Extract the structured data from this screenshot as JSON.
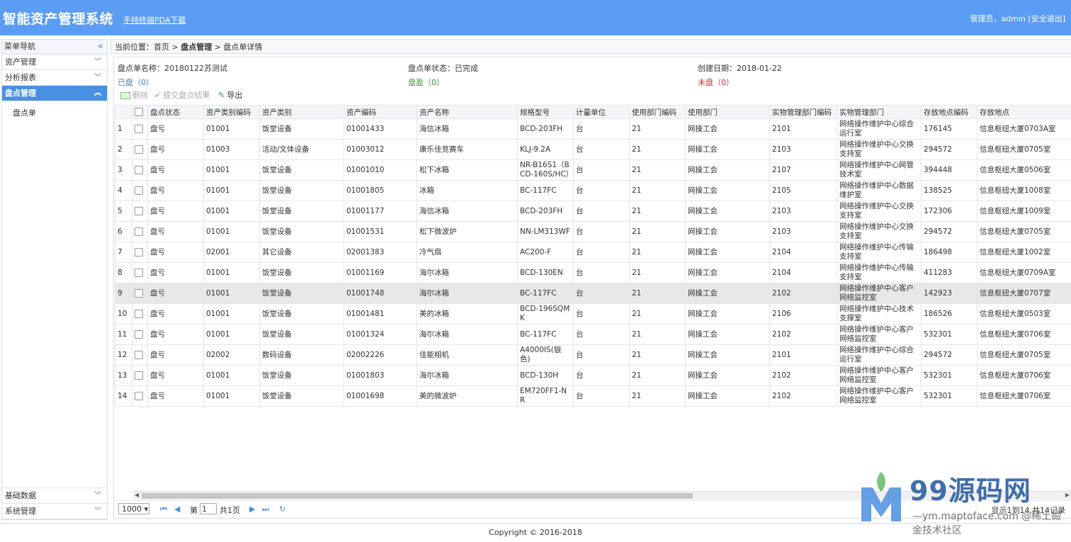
{
  "header": {
    "title": "智能资产管理系统",
    "pda_link": "手持终端PDA下载",
    "user": "管理员，admin",
    "logout": "[安全退出]"
  },
  "sidebar": {
    "heading": "菜单导航",
    "sections": [
      {
        "label": "资产管理"
      },
      {
        "label": "分析报表"
      },
      {
        "label": "盘点管理"
      }
    ],
    "sub_items": [
      {
        "label": "盘点单"
      }
    ],
    "bottom_sections": [
      {
        "label": "基础数据"
      },
      {
        "label": "系统管理"
      }
    ]
  },
  "breadcrumb": {
    "prefix": "当前位置：首页 >",
    "level1": "盘点管理",
    "level2": "> 盘点单详情"
  },
  "info": {
    "name": "盘点单名称：20180122苏测试",
    "status": "盘点单状态：已完成",
    "date": "创建日期：2018-01-22",
    "counted": "已盘（0）",
    "surplus": "盘盈（0）",
    "uncounted": "未盘（0）"
  },
  "toolbar": {
    "delete": "删除",
    "submit": "提交盘点结果",
    "export": "导出"
  },
  "table": {
    "columns": [
      "盘点状态",
      "资产类别编码",
      "资产类别",
      "资产编码",
      "资产名称",
      "规格型号",
      "计量单位",
      "使用部门编码",
      "使用部门",
      "实物管理部门编码",
      "实物管理部门",
      "存放地点编码",
      "存放地点"
    ],
    "rows": [
      [
        "1",
        "盘亏",
        "01001",
        "饭堂设备",
        "01001433",
        "海信冰箱",
        "BCD-203FH",
        "台",
        "21",
        "网操工会",
        "2101",
        "网络操作维护中心综合运行室",
        "176145",
        "信息枢纽大厦0703A室"
      ],
      [
        "2",
        "盘亏",
        "01003",
        "活动/文体设备",
        "01003012",
        "康乐佳竞赛车",
        "KLJ-9.2A",
        "台",
        "21",
        "网操工会",
        "2103",
        "网络操作维护中心交换支持室",
        "294572",
        "信息枢纽大厦0705室"
      ],
      [
        "3",
        "盘亏",
        "01001",
        "饭堂设备",
        "01001010",
        "松下冰箱",
        "NR-B16S1（BCD-160S/HC）",
        "台",
        "21",
        "网操工会",
        "2107",
        "网络操作维护中心网管技术室",
        "394448",
        "信息枢纽大厦0506室"
      ],
      [
        "4",
        "盘亏",
        "01001",
        "饭堂设备",
        "01001805",
        "冰箱",
        "BC-117FC",
        "台",
        "21",
        "网操工会",
        "2105",
        "网络操作维护中心数据维护室",
        "138525",
        "信息枢纽大厦1008室"
      ],
      [
        "5",
        "盘亏",
        "01001",
        "饭堂设备",
        "01001177",
        "海信冰箱",
        "BCD-203FH",
        "台",
        "21",
        "网操工会",
        "2103",
        "网络操作维护中心交换支持室",
        "172306",
        "信息枢纽大厦1009室"
      ],
      [
        "6",
        "盘亏",
        "01001",
        "饭堂设备",
        "01001531",
        "松下微波炉",
        "NN-LM313WF",
        "台",
        "21",
        "网操工会",
        "2103",
        "网络操作维护中心交换支持室",
        "294572",
        "信息枢纽大厦0705室"
      ],
      [
        "7",
        "盘亏",
        "02001",
        "其它设备",
        "02001383",
        "冷气扇",
        "AC200-F",
        "台",
        "21",
        "网操工会",
        "2104",
        "网络操作维护中心传输支持室",
        "186498",
        "信息枢纽大厦1002室"
      ],
      [
        "8",
        "盘亏",
        "01001",
        "饭堂设备",
        "01001169",
        "海尔冰箱",
        "BCD-130EN",
        "台",
        "21",
        "网操工会",
        "2104",
        "网络操作维护中心传输支持室",
        "411283",
        "信息枢纽大厦0709A室"
      ],
      [
        "9",
        "盘亏",
        "01001",
        "饭堂设备",
        "01001748",
        "海尔冰箱",
        "BC-117FC",
        "台",
        "21",
        "网操工会",
        "2102",
        "网络操作维护中心客户网络监控室",
        "142923",
        "信息枢纽大厦0707室"
      ],
      [
        "10",
        "盘亏",
        "01001",
        "饭堂设备",
        "01001481",
        "美的冰箱",
        "BCD-196SQMK",
        "台",
        "21",
        "网操工会",
        "2106",
        "网络操作维护中心技术支撑室",
        "186526",
        "信息枢纽大厦0503室"
      ],
      [
        "11",
        "盘亏",
        "01001",
        "饭堂设备",
        "01001324",
        "海尔冰箱",
        "BC-117FC",
        "台",
        "21",
        "网操工会",
        "2102",
        "网络操作维护中心客户网络监控室",
        "532301",
        "信息枢纽大厦0706室"
      ],
      [
        "12",
        "盘亏",
        "02002",
        "数码设备",
        "02002226",
        "佳能相机",
        "A4000IS(银色)",
        "台",
        "21",
        "网操工会",
        "2101",
        "网络操作维护中心综合运行室",
        "294572",
        "信息枢纽大厦0705室"
      ],
      [
        "13",
        "盘亏",
        "01001",
        "饭堂设备",
        "01001803",
        "海尔冰箱",
        "BCD-130H",
        "台",
        "21",
        "网操工会",
        "2102",
        "网络操作维护中心客户网络监控室",
        "532301",
        "信息枢纽大厦0706室"
      ],
      [
        "14",
        "盘亏",
        "01001",
        "饭堂设备",
        "01001698",
        "美的微波炉",
        "EM720FF1-NR",
        "台",
        "21",
        "网操工会",
        "2102",
        "网络操作维护中心客户网络监控室",
        "532301",
        "信息枢纽大厦0706室"
      ]
    ],
    "selected_row": 9
  },
  "pager": {
    "page_size": "1000",
    "page_label": "第",
    "page_value": "1",
    "total_pages": "共1页",
    "display": "显示1到14,共14记录"
  },
  "footer": {
    "copyright": "Copyright © 2016-2018"
  },
  "watermark": {
    "brand": "99源码网",
    "sub": "—ym.maptoface.com  @稀土掘金技术社区"
  },
  "colors": {
    "header_bg": "#5b9cf5",
    "active_section": "#4a90e2",
    "green": "#3a9a3a",
    "red": "#cc3333"
  }
}
